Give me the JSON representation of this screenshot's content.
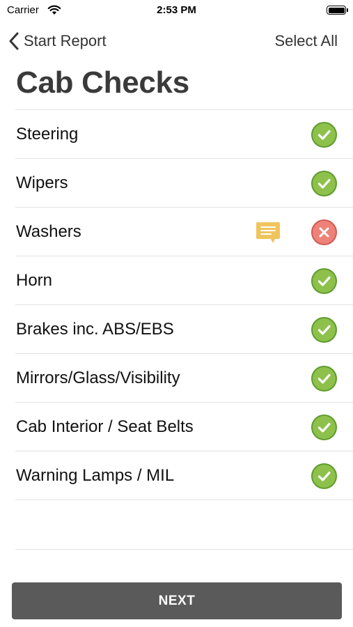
{
  "status_bar": {
    "carrier": "Carrier",
    "time": "2:53 PM"
  },
  "nav": {
    "back_label": "Start Report",
    "select_all": "Select All"
  },
  "title": "Cab Checks",
  "items": [
    {
      "label": "Steering",
      "status": "pass",
      "has_comment": false
    },
    {
      "label": "Wipers",
      "status": "pass",
      "has_comment": false
    },
    {
      "label": "Washers",
      "status": "fail",
      "has_comment": true
    },
    {
      "label": "Horn",
      "status": "pass",
      "has_comment": false
    },
    {
      "label": "Brakes inc. ABS/EBS",
      "status": "pass",
      "has_comment": false
    },
    {
      "label": "Mirrors/Glass/Visibility",
      "status": "pass",
      "has_comment": false
    },
    {
      "label": "Cab Interior / Seat Belts",
      "status": "pass",
      "has_comment": false
    },
    {
      "label": "Warning Lamps / MIL",
      "status": "pass",
      "has_comment": false
    }
  ],
  "next_label": "NEXT",
  "colors": {
    "pass": "#8dc14b",
    "fail": "#ee8279",
    "comment": "#f0c45c",
    "button": "#5a5a5a"
  },
  "icons": {
    "pass": "check-circle-icon",
    "fail": "x-circle-icon",
    "comment": "comment-bubble-icon",
    "back": "chevron-left-icon"
  }
}
